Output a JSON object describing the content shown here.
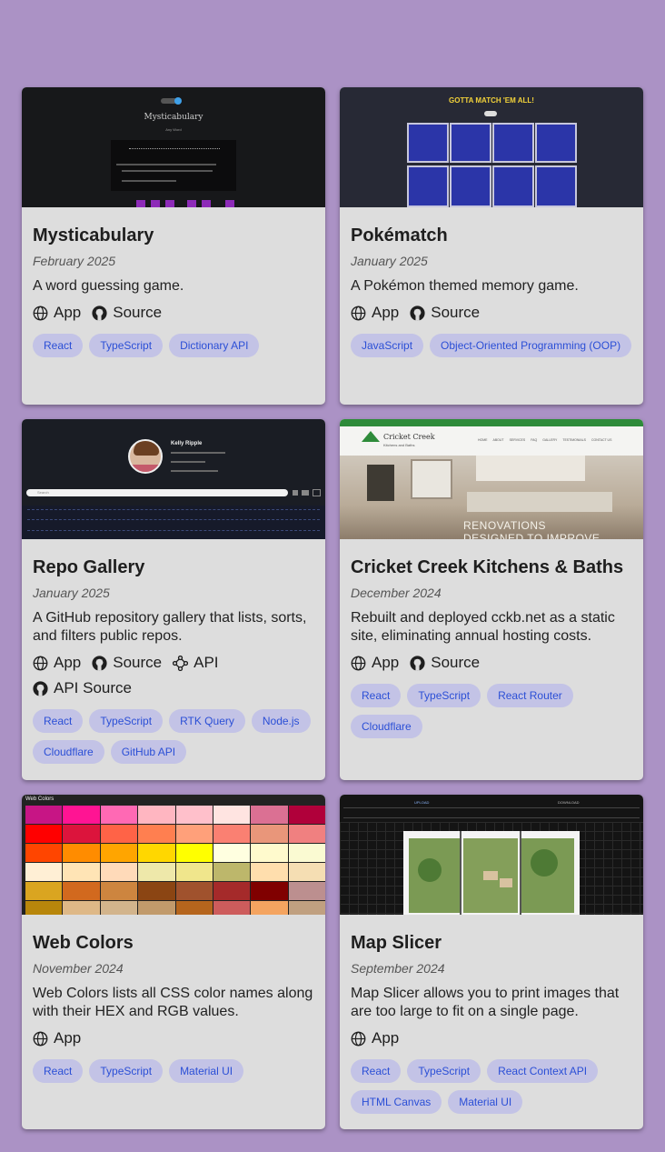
{
  "projects": [
    {
      "title": "Mysticabulary",
      "date": "February 2025",
      "description": "A word guessing game.",
      "links": {
        "app": "App",
        "source": "Source"
      },
      "tags": [
        "React",
        "TypeScript",
        "Dictionary API"
      ],
      "thumb": {
        "title": "Mysticabulary",
        "subtitle": "Any Word"
      }
    },
    {
      "title": "Pokématch",
      "date": "January 2025",
      "description": "A Pokémon themed memory game.",
      "links": {
        "app": "App",
        "source": "Source"
      },
      "tags": [
        "JavaScript",
        "Object-Oriented Programming (OOP)"
      ],
      "thumb": {
        "title": "GOTTA MATCH 'EM ALL!"
      }
    },
    {
      "title": "Repo Gallery",
      "date": "January 2025",
      "description": "A GitHub repository gallery that lists, sorts, and filters public repos.",
      "links": {
        "app": "App",
        "source": "Source",
        "api": "API",
        "api_source": "API Source"
      },
      "tags": [
        "React",
        "TypeScript",
        "RTK Query",
        "Node.js",
        "Cloudflare",
        "GitHub API"
      ],
      "thumb": {
        "name": "Kelly Ripple",
        "search": "Search"
      }
    },
    {
      "title": "Cricket Creek Kitchens & Baths",
      "date": "December 2024",
      "description": "Rebuilt and deployed cckb.net as a static site, eliminating annual hosting costs.",
      "links": {
        "app": "App",
        "source": "Source"
      },
      "tags": [
        "React",
        "TypeScript",
        "React Router",
        "Cloudflare"
      ],
      "thumb": {
        "brand": "Cricket Creek",
        "brand_sub": "Kitchens and Baths",
        "hero": "RENOVATIONS",
        "hero2": "DESIGNED TO IMPROVE",
        "nav": [
          "HOME",
          "ABOUT",
          "SERVICES",
          "FAQ",
          "GALLERY",
          "TESTIMONIALS",
          "CONTACT US"
        ]
      }
    },
    {
      "title": "Web Colors",
      "date": "November 2024",
      "description": "Web Colors lists all CSS color names along with their HEX and RGB values.",
      "links": {
        "app": "App"
      },
      "tags": [
        "React",
        "TypeScript",
        "Material UI"
      ],
      "thumb": {
        "header": "Web Colors"
      }
    },
    {
      "title": "Map Slicer",
      "date": "September 2024",
      "description": "Map Slicer allows you to print images that are too large to fit on a single page.",
      "links": {
        "app": "App"
      },
      "tags": [
        "React",
        "TypeScript",
        "React Context API",
        "HTML Canvas",
        "Material UI"
      ],
      "thumb": {
        "upload": "UPLOAD",
        "download": "DOWNLOAD"
      }
    }
  ],
  "colors": {
    "background": "#ab92c5",
    "card": "#dddddd",
    "tag_bg": "#c3c3e6",
    "tag_text": "#2b4fd6"
  }
}
